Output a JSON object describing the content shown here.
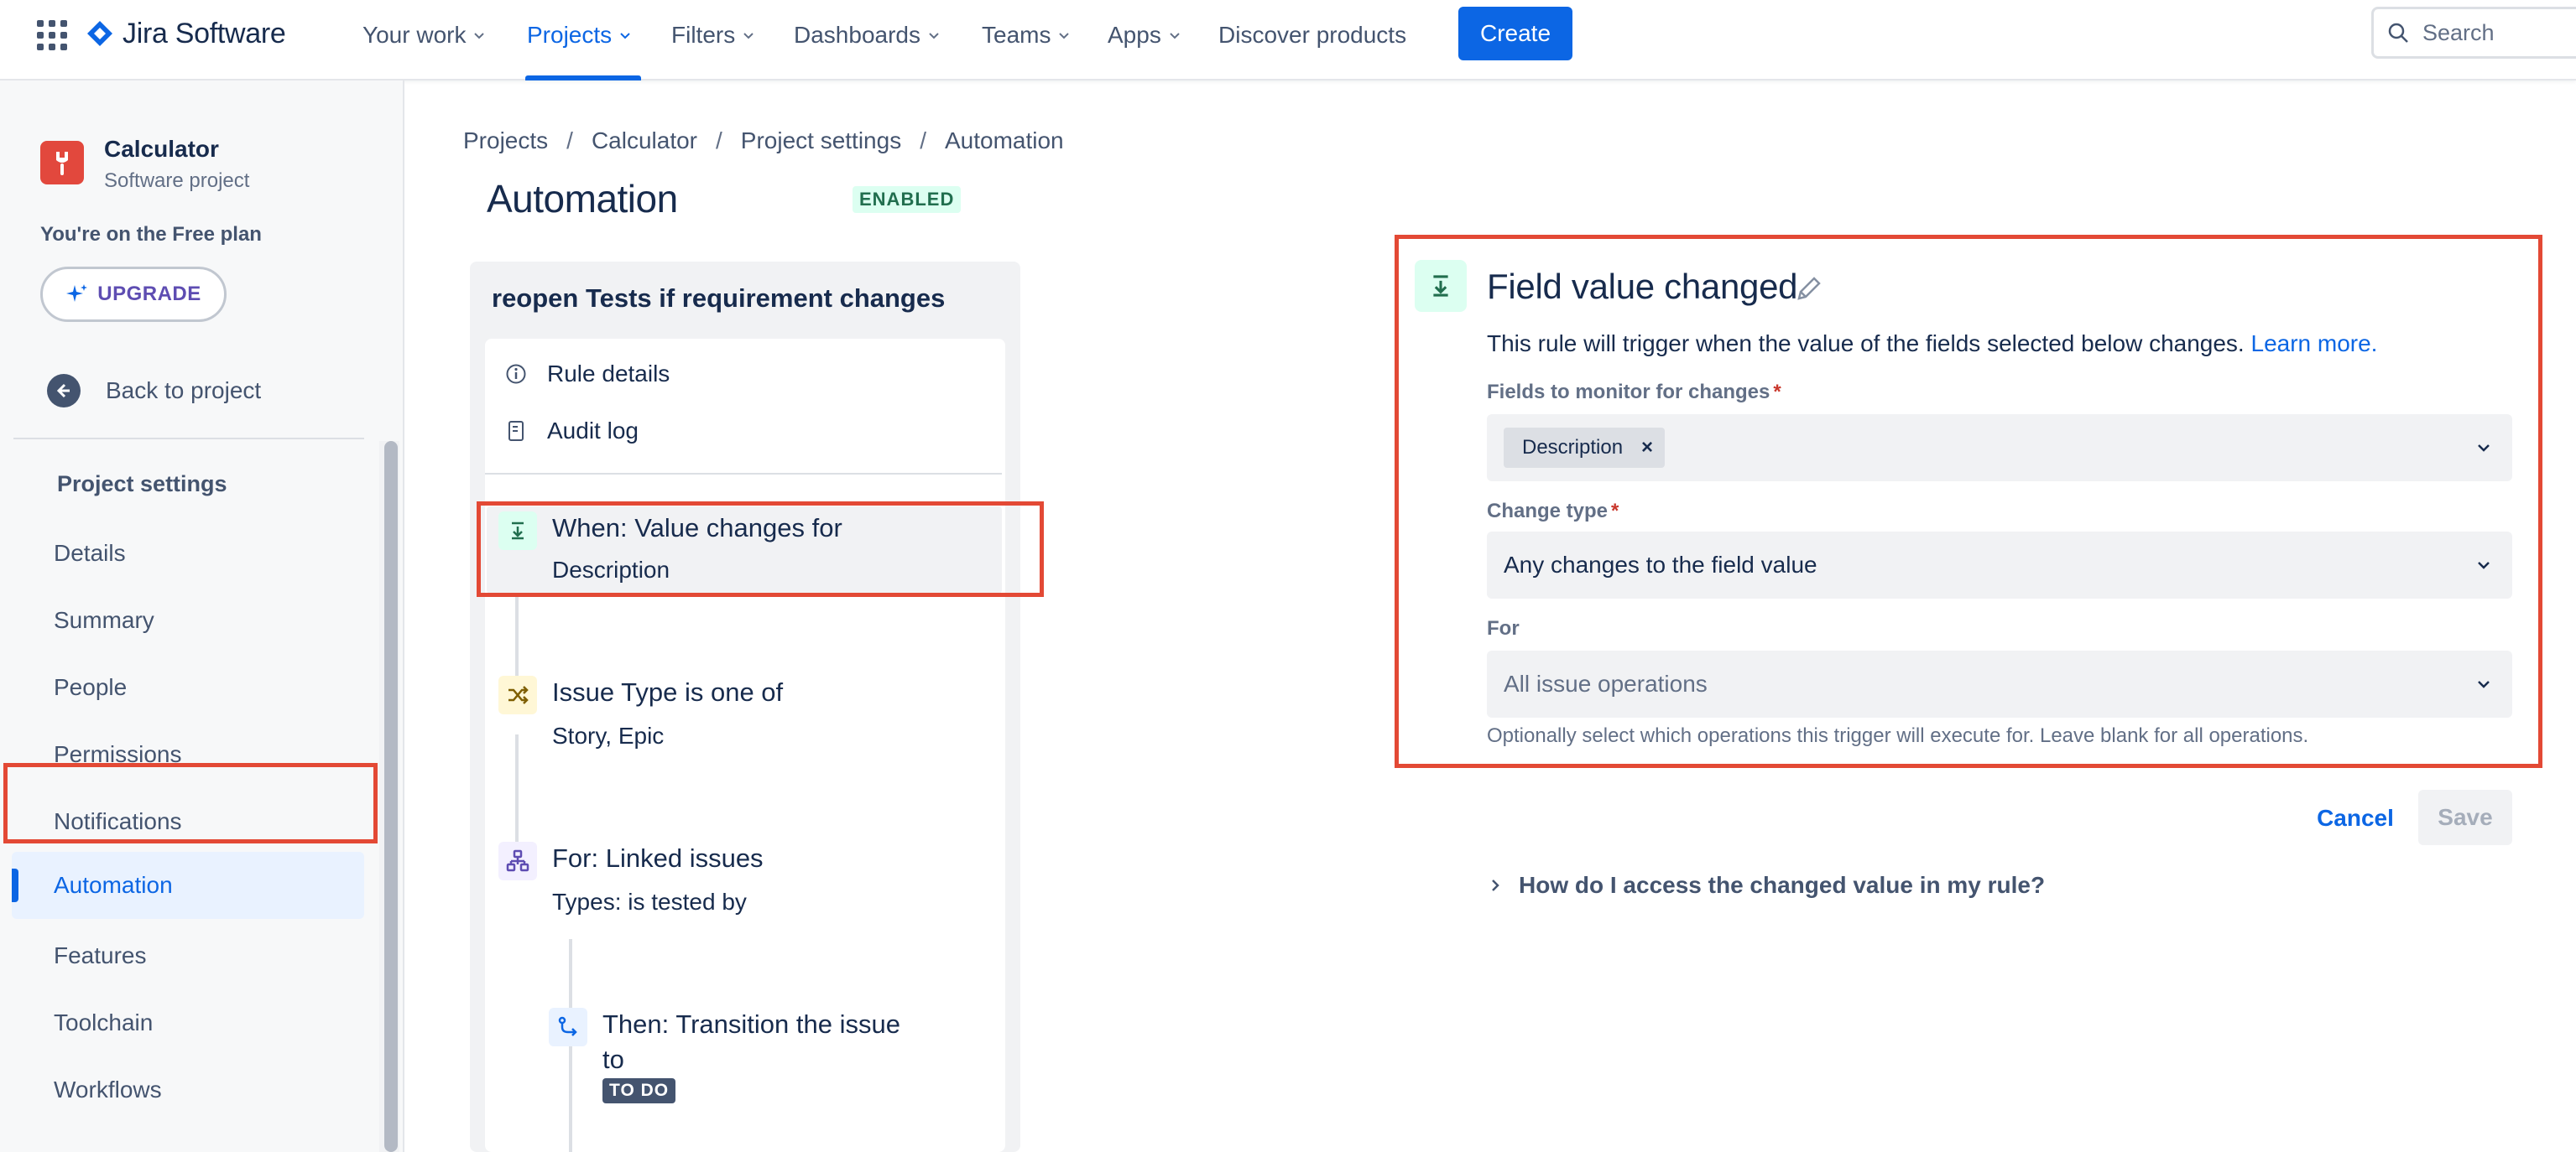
{
  "topnav": {
    "logo_text": "Jira Software",
    "items": [
      {
        "label": "Your work"
      },
      {
        "label": "Projects"
      },
      {
        "label": "Filters"
      },
      {
        "label": "Dashboards"
      },
      {
        "label": "Teams"
      },
      {
        "label": "Apps"
      },
      {
        "label": "Discover products"
      }
    ],
    "create_label": "Create",
    "search_placeholder": "Search"
  },
  "sidebar": {
    "project_name": "Calculator",
    "project_type": "Software project",
    "plan_text": "You're on the Free plan",
    "upgrade_label": "UPGRADE",
    "back_label": "Back to project",
    "section_heading": "Project settings",
    "items": [
      {
        "label": "Details"
      },
      {
        "label": "Summary"
      },
      {
        "label": "People"
      },
      {
        "label": "Permissions"
      },
      {
        "label": "Notifications"
      },
      {
        "label": "Automation"
      },
      {
        "label": "Features"
      },
      {
        "label": "Toolchain"
      },
      {
        "label": "Workflows"
      }
    ],
    "active_item": "Automation"
  },
  "breadcrumb": [
    "Projects",
    "Calculator",
    "Project settings",
    "Automation"
  ],
  "page": {
    "title": "Automation",
    "status_badge": "ENABLED"
  },
  "rule": {
    "name": "reopen Tests if requirement changes",
    "links": [
      {
        "label": "Rule details"
      },
      {
        "label": "Audit log"
      }
    ],
    "steps": [
      {
        "title": "When: Value changes for",
        "subtitle": "Description"
      },
      {
        "title": "Issue Type is one of",
        "subtitle": "Story, Epic"
      },
      {
        "title": "For: Linked issues",
        "subtitle": "Types: is tested by"
      },
      {
        "title_line1": "Then: Transition the issue",
        "title_line2": "to",
        "badge": "TO DO"
      }
    ]
  },
  "panel": {
    "title": "Field value changed",
    "description": "This rule will trigger when the value of the fields selected below changes.",
    "learn_more": "Learn more.",
    "fields_label": "Fields to monitor for changes",
    "fields_chip": "Description",
    "change_type_label": "Change type",
    "change_type_value": "Any changes to the field value",
    "for_label": "For",
    "for_placeholder": "All issue operations",
    "helper_text": "Optionally select which operations this trigger will execute for. Leave blank for all operations.",
    "cancel_label": "Cancel",
    "save_label": "Save",
    "faq_label": "How do I access the changed value in my rule?"
  },
  "colors": {
    "primary": "#0c66e4",
    "highlight_box": "#e34935",
    "enabled_bg": "#dcfff1",
    "enabled_text": "#216e4e"
  }
}
